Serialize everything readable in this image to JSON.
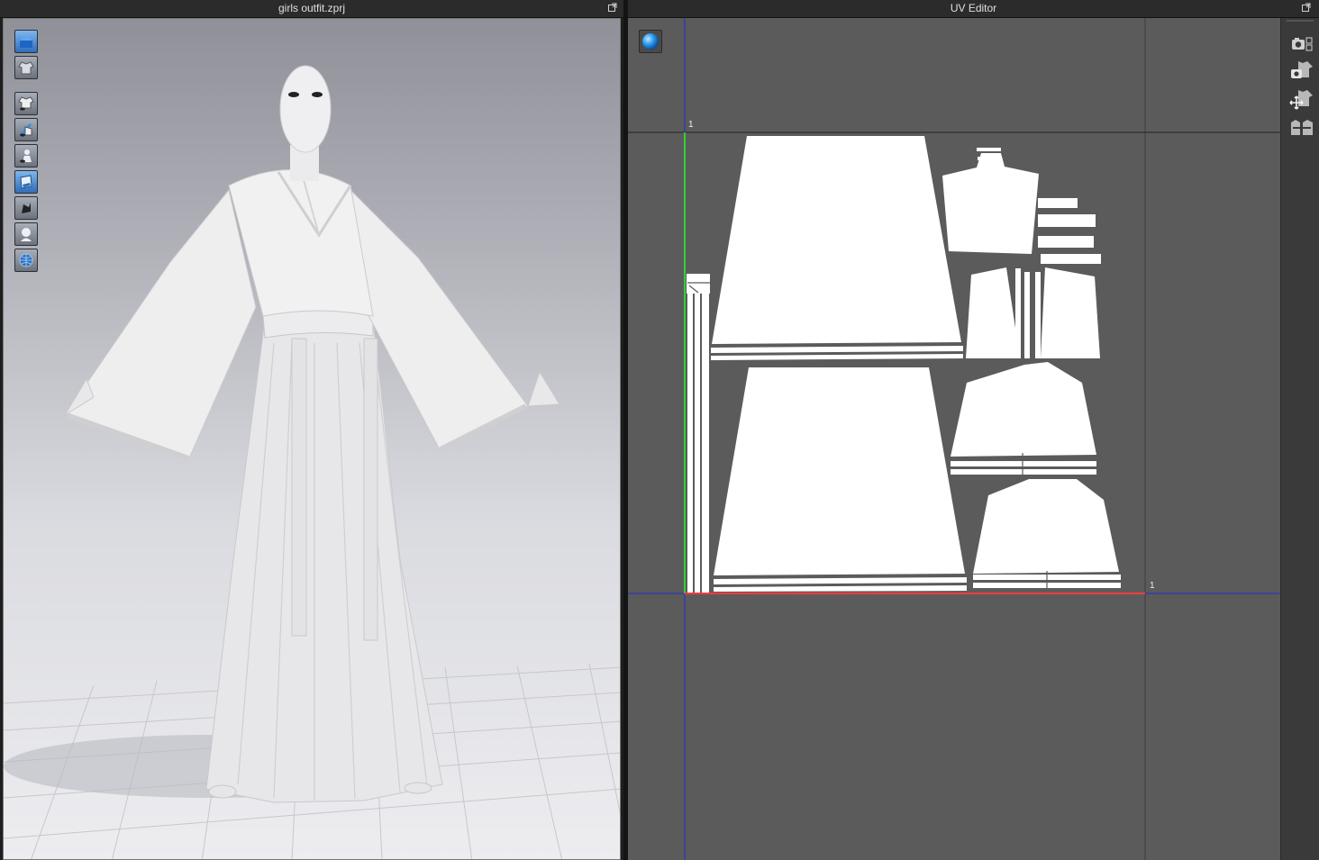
{
  "left_panel": {
    "title": "girls outfit.zprj"
  },
  "right_panel": {
    "title": "UV Editor"
  },
  "uv_axes": {
    "u_label": "1",
    "v_label": "1"
  },
  "toolbar_icons": [
    "scene-view-icon",
    "garment-view-icon",
    "show-garment-icon",
    "show-brush-icon",
    "show-avatar-icon",
    "texture-mode-icon",
    "fabric-icon",
    "avatar-silhouette-icon",
    "globe-icon"
  ],
  "sidebar_icons": [
    "uv-snapshot-icon",
    "uv-capture-icon",
    "uv-move-icon",
    "uv-arrange-icon"
  ],
  "colors": {
    "accent": "#3a8ee6",
    "uv_u_axis": "#ff3b3b",
    "uv_v_axis": "#2fd12f",
    "grid_line": "#2a2ad0"
  }
}
